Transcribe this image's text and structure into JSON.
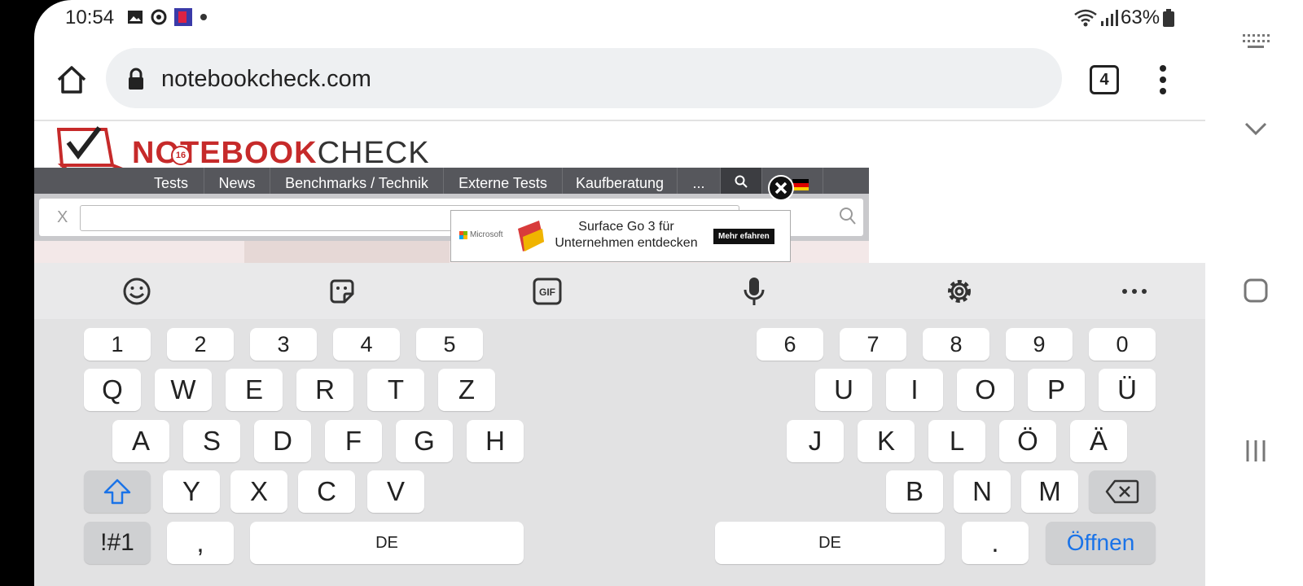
{
  "status_bar": {
    "time": "10:54",
    "battery": "63%"
  },
  "browser": {
    "url": "notebookcheck.com",
    "tab_count": "4"
  },
  "site": {
    "logo_red": "NOTEBOOK",
    "logo_gray": "CHECK",
    "logo_badge": "16",
    "nav_items": [
      "Tests",
      "News",
      "Benchmarks / Technik",
      "Externe Tests",
      "Kaufberatung",
      "..."
    ],
    "search_close": "X"
  },
  "ad": {
    "brand": "Microsoft",
    "text_line1": "Surface Go 3 für",
    "text_line2": "Unternehmen entdecken",
    "button": "Mehr efahren"
  },
  "keyboard": {
    "numbers_left": [
      "1",
      "2",
      "3",
      "4",
      "5"
    ],
    "numbers_right": [
      "6",
      "7",
      "8",
      "9",
      "0"
    ],
    "row1_left": [
      "Q",
      "W",
      "E",
      "R",
      "T",
      "Z"
    ],
    "row1_right": [
      "U",
      "I",
      "O",
      "P",
      "Ü"
    ],
    "row2_left": [
      "A",
      "S",
      "D",
      "F",
      "G",
      "H"
    ],
    "row2_right": [
      "J",
      "K",
      "L",
      "Ö",
      "Ä"
    ],
    "row3_left": [
      "Y",
      "X",
      "C",
      "V"
    ],
    "row3_right": [
      "B",
      "N",
      "M"
    ],
    "symbols_key": "!#1",
    "comma_key": ",",
    "space_left": "DE",
    "space_right": "DE",
    "period_key": ".",
    "enter_key": "Öffnen",
    "accent_color": "#1a73e8"
  }
}
